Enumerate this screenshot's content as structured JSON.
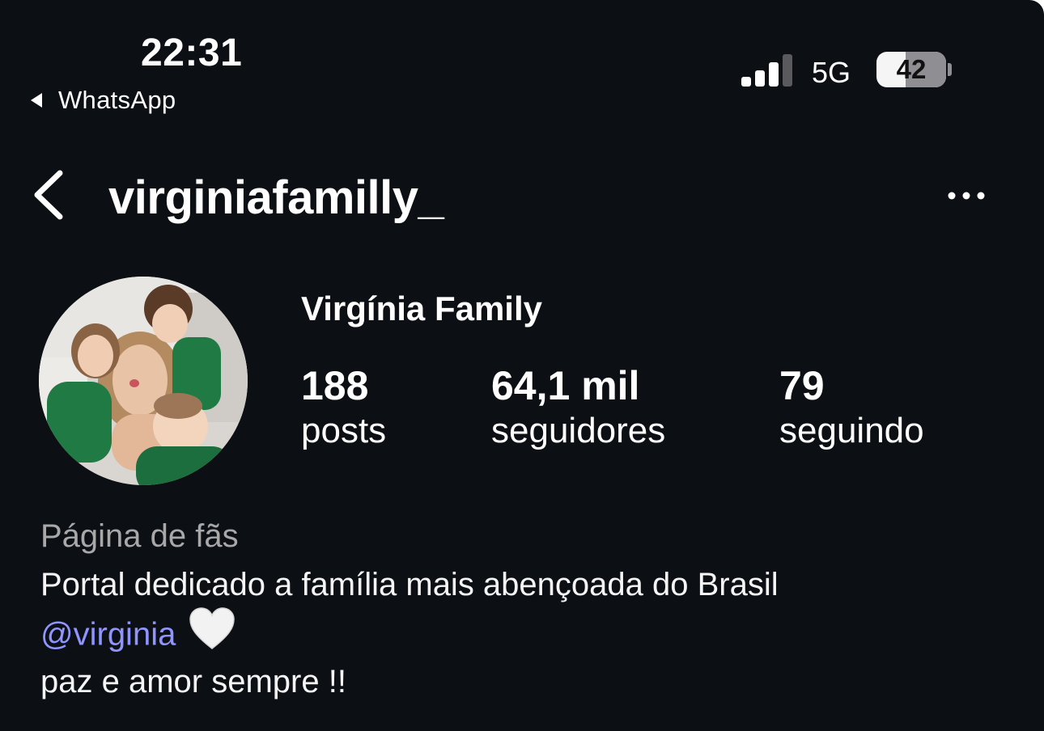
{
  "status_bar": {
    "time": "22:31",
    "back_app": "WhatsApp",
    "signal_bars": 3,
    "network": "5G",
    "battery_percent": "42",
    "battery_level": 0.42
  },
  "header": {
    "username": "virginiafamilly_",
    "back_icon": "chevron-left-icon",
    "more_icon": "more-horizontal-icon"
  },
  "profile": {
    "display_name": "Virgínia Family",
    "stats": [
      {
        "value": "188",
        "label": "posts"
      },
      {
        "value": "64,1 mil",
        "label": "seguidores"
      },
      {
        "value": "79",
        "label": "seguindo"
      }
    ]
  },
  "bio": {
    "category": "Página de fãs",
    "line1": "Portal dedicado a família mais abençoada do Brasil",
    "mention": "@virginia",
    "heart_icon": "white-heart-icon",
    "line3": "paz e amor sempre !!"
  },
  "colors": {
    "background": "#0c1014",
    "text": "#f5f5f5",
    "muted": "#a8a8a8",
    "mention": "#8f94ff"
  }
}
